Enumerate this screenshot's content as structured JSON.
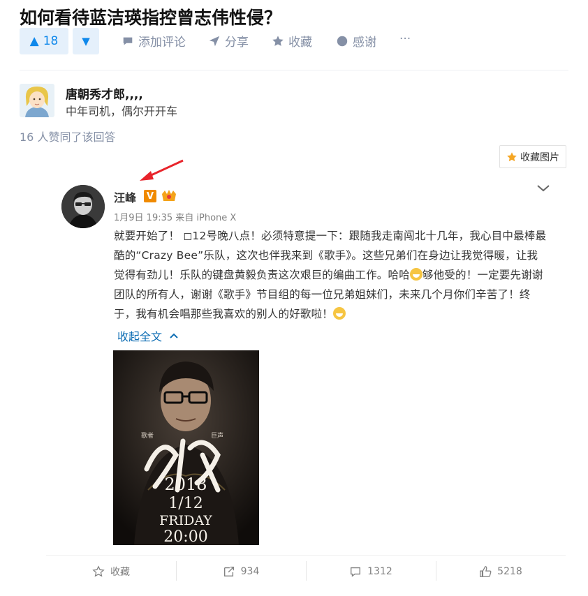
{
  "question": {
    "title": "如何看待蓝洁瑛指控曾志伟性侵？"
  },
  "actions": {
    "vote_count": "18",
    "comment": "添加评论",
    "share": "分享",
    "collect": "收藏",
    "thanks": "感谢",
    "more": "···"
  },
  "author": {
    "name": "唐朝秀才郎,,,,",
    "bio": "中年司机，偶尔开开车"
  },
  "upvoters": "16 人赞同了该回答",
  "save_image": "收藏图片",
  "weibo": {
    "name": "汪峰",
    "v_badge": "V",
    "meta": "1月9日 19:35 来自 iPhone X",
    "text_1": "就要开始了！ ◻12号晚八点！必须特意提一下：跟随我走南闯北十几年，我心目中最棒最酷的“Crazy Bee”乐队，这次也伴我来到《歌手》。这些兄弟们在身边让我觉得暖，让我觉得有劲儿！乐队的键盘黄毅负责这次艰巨的编曲工作。哈哈",
    "text_2": "够他受的！一定要先谢谢团队的所有人，谢谢《歌手》节目组的每一位兄弟姐妹们，未来几个月你们辛苦了！终于，我有机会唱那些我喜欢的别人的好歌啦！",
    "collapse": "收起全文",
    "poster": {
      "year": "2018",
      "date": "1/12",
      "day": "FRIDAY",
      "time": "20:00",
      "label_left": "歌者",
      "label_right": "巨声"
    },
    "footer": {
      "collect": "收藏",
      "repost": "934",
      "comment": "1312",
      "like": "5218"
    }
  }
}
